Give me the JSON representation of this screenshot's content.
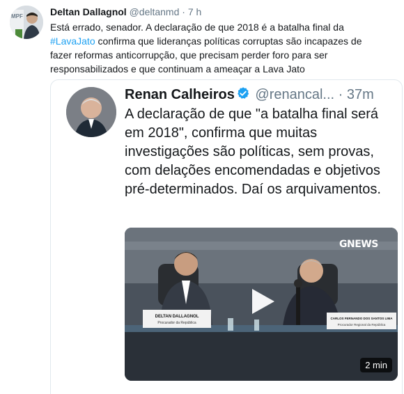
{
  "tweet": {
    "author_name": "Deltan Dallagnol",
    "author_handle": "@deltanmd",
    "separator": "·",
    "time": "7 h",
    "text_before": "Está errado, senador. A declaração de que 2018 é a batalha final da ",
    "hashtag": "#LavaJato",
    "text_after": " confirma que lideranças políticas corruptas são incapazes de fazer reformas anticorrupção, que precisam perder foro para ser responsabilizados e que continuam a ameaçar a Lava Jato",
    "avatar_badge": "MPF"
  },
  "quoted": {
    "author_name": "Renan Calheiros",
    "author_handle": "@renancal...",
    "separator": "·",
    "time": "37m",
    "text": "A declaração de que \"a batalha final será em 2018\", confirma que muitas investigações são políticas, sem provas, com delações encomendadas e objetivos pré-determinados. Daí os arquivamentos.",
    "video": {
      "channel_logo": "GNEWS",
      "duration": "2 min",
      "nameplate_left_name": "DELTAN DALLAGNOL",
      "nameplate_left_role": "Procurador da República",
      "nameplate_right_name": "CARLOS FERNANDO DOS SANTOS LIMA",
      "nameplate_right_role": "Procurador Regional da República"
    }
  },
  "colors": {
    "link": "#1da1f2",
    "verified": "#1da1f2",
    "secondary_text": "#657786",
    "border": "#e1e8ed"
  }
}
